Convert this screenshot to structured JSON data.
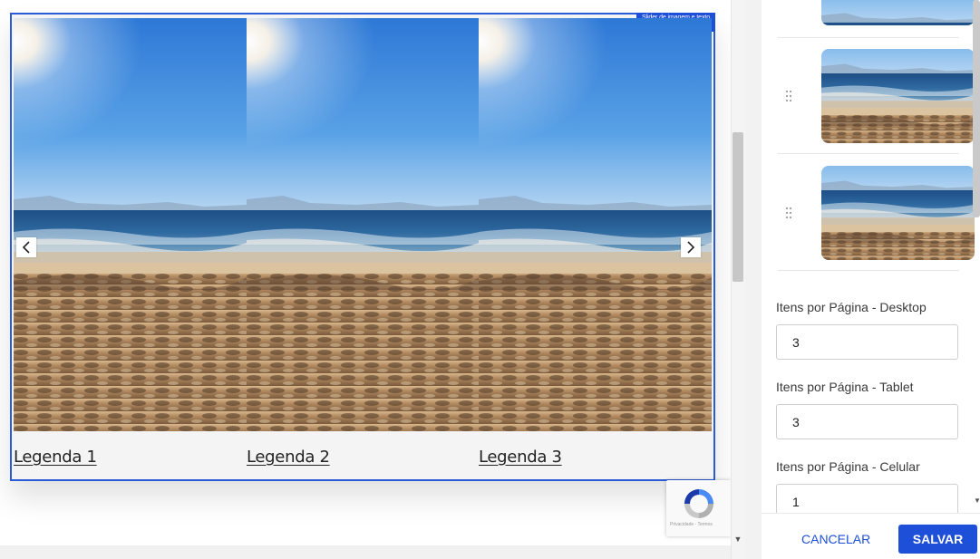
{
  "slider": {
    "badge": "Slider de imagem e texto",
    "slides": [
      {
        "caption": "Legenda 1",
        "image": "beach-photo"
      },
      {
        "caption": "Legenda 2",
        "image": "beach-photo"
      },
      {
        "caption": "Legenda 3",
        "image": "beach-photo"
      }
    ],
    "prev_icon": "chevron-left-icon",
    "next_icon": "chevron-right-icon"
  },
  "recaptcha": {
    "footer_text": "Privacidade - Termos"
  },
  "settings": {
    "thumbnails": [
      "beach-photo",
      "beach-photo",
      "beach-photo"
    ],
    "fields": [
      {
        "label": "Itens por Página - Desktop",
        "value": "3"
      },
      {
        "label": "Itens por Página - Tablet",
        "value": "3"
      },
      {
        "label": "Itens por Página - Celular",
        "value": "1"
      }
    ]
  },
  "footer": {
    "cancel_label": "CANCELAR",
    "save_label": "SALVAR"
  },
  "colors": {
    "accent": "#1d4fd8",
    "selection_border": "#2a5bd7"
  }
}
